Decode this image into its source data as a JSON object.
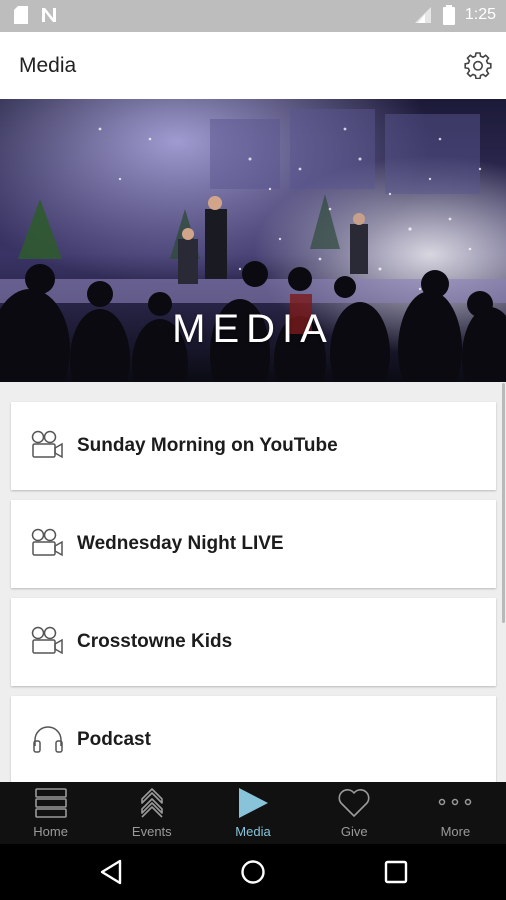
{
  "status_bar": {
    "time": "1:25"
  },
  "header": {
    "title": "Media"
  },
  "hero": {
    "title": "MEDIA"
  },
  "items": [
    {
      "label": "Sunday Morning on YouTube",
      "icon": "video-camera-icon"
    },
    {
      "label": "Wednesday Night LIVE",
      "icon": "video-camera-icon"
    },
    {
      "label": "Crosstowne Kids",
      "icon": "video-camera-icon"
    },
    {
      "label": "Podcast",
      "icon": "headphones-icon"
    }
  ],
  "tabs": [
    {
      "label": "Home",
      "icon": "home-icon"
    },
    {
      "label": "Events",
      "icon": "events-icon"
    },
    {
      "label": "Media",
      "icon": "play-icon",
      "active": true
    },
    {
      "label": "Give",
      "icon": "heart-icon"
    },
    {
      "label": "More",
      "icon": "more-icon"
    }
  ],
  "colors": {
    "accent": "#88c3d9",
    "tabbar": "#111111",
    "status_bar": "#bdbdbd"
  }
}
